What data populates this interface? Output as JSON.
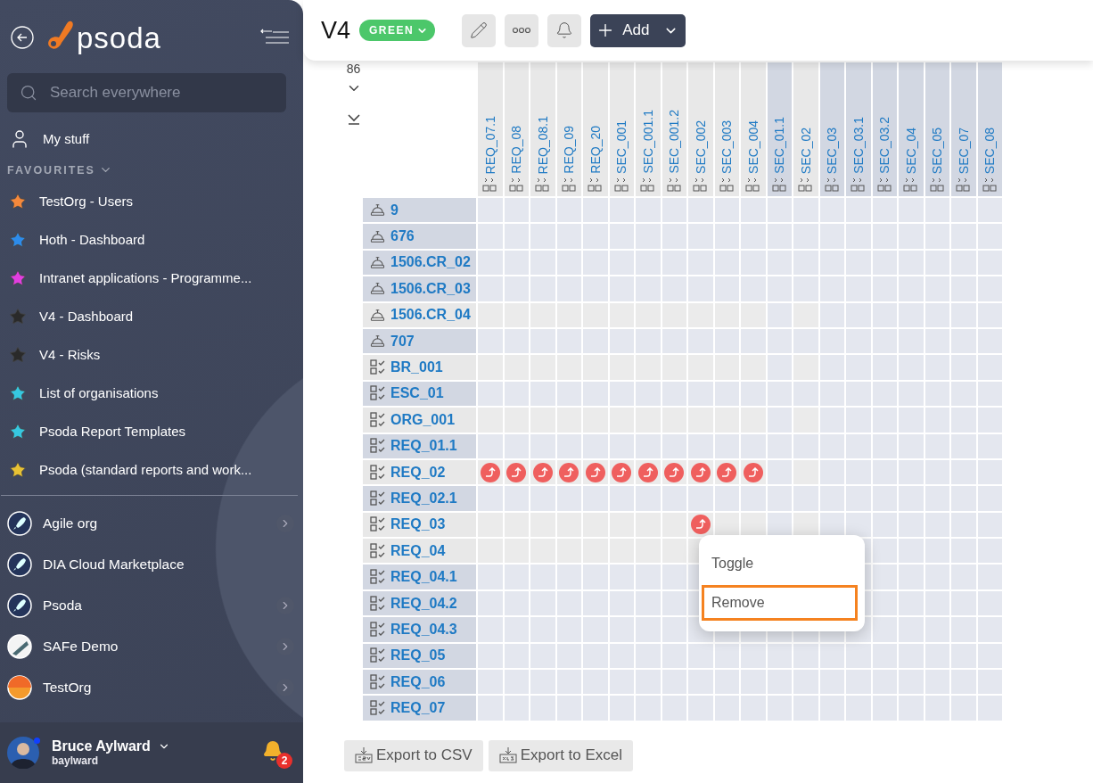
{
  "sidebar": {
    "logo": "psoda",
    "search": {
      "placeholder": "Search everywhere"
    },
    "my_stuff": "My stuff",
    "favourites": {
      "label": "FAVOURITES",
      "expanded": true,
      "items": [
        {
          "label": "TestOrg - Users",
          "color": "#f5893c"
        },
        {
          "label": "Hoth - Dashboard",
          "color": "#2d8ceb"
        },
        {
          "label": "Intranet applications - Programme...",
          "color": "#e23ee0"
        },
        {
          "label": "V4 - Dashboard",
          "color": "#2a2a2a"
        },
        {
          "label": "V4 - Risks",
          "color": "#2a2a2a"
        },
        {
          "label": "List of organisations",
          "color": "#36c8e0"
        },
        {
          "label": "Psoda Report Templates",
          "color": "#36c8e0"
        },
        {
          "label": "Psoda (standard reports and work...",
          "color": "#e8c234"
        }
      ]
    },
    "organisations": [
      {
        "label": "Agile org",
        "kind": "rocket",
        "has_children": true
      },
      {
        "label": "DIA Cloud Marketplace",
        "kind": "rocket",
        "has_children": false
      },
      {
        "label": "Psoda",
        "kind": "rocket",
        "has_children": true
      },
      {
        "label": "SAFe Demo",
        "kind": "stripes",
        "has_children": true
      },
      {
        "label": "TestOrg",
        "kind": "sunset",
        "has_children": true
      }
    ],
    "user": {
      "name": "Bruce Aylward",
      "username": "baylward",
      "online": true,
      "notifications": "2"
    }
  },
  "header": {
    "title": "V4",
    "status": "GREEN",
    "add_button": "Add"
  },
  "matrix": {
    "count": "86",
    "columns": [
      {
        "label": "REQ_07.1",
        "shaded": true
      },
      {
        "label": "REQ_08",
        "shaded": true
      },
      {
        "label": "REQ_08.1",
        "shaded": true
      },
      {
        "label": "REQ_09",
        "shaded": true
      },
      {
        "label": "REQ_20",
        "shaded": true
      },
      {
        "label": "SEC_001",
        "shaded": true
      },
      {
        "label": "SEC_001.1",
        "shaded": true
      },
      {
        "label": "SEC_001.2",
        "shaded": true
      },
      {
        "label": "SEC_002",
        "shaded": true
      },
      {
        "label": "SEC_003",
        "shaded": true
      },
      {
        "label": "SEC_004",
        "shaded": true
      },
      {
        "label": "SEC_01.1",
        "shaded": false
      },
      {
        "label": "SEC_02",
        "shaded": true
      },
      {
        "label": "SEC_03",
        "shaded": false
      },
      {
        "label": "SEC_03.1",
        "shaded": false
      },
      {
        "label": "SEC_03.2",
        "shaded": false
      },
      {
        "label": "SEC_04",
        "shaded": false
      },
      {
        "label": "SEC_05",
        "shaded": false
      },
      {
        "label": "SEC_07",
        "shaded": false
      },
      {
        "label": "SEC_08",
        "shaded": false
      }
    ],
    "rows": [
      {
        "label": "9",
        "kind": "bell",
        "shaded": false,
        "links": [
          false,
          false,
          false,
          false,
          false,
          false,
          false,
          false,
          false,
          false,
          false,
          false,
          false,
          false,
          false,
          false,
          false,
          false,
          false,
          false
        ]
      },
      {
        "label": "676",
        "kind": "bell",
        "shaded": false,
        "links": [
          false,
          false,
          false,
          false,
          false,
          false,
          false,
          false,
          false,
          false,
          false,
          false,
          false,
          false,
          false,
          false,
          false,
          false,
          false,
          false
        ]
      },
      {
        "label": "1506.CR_02",
        "kind": "bell",
        "shaded": false,
        "links": [
          false,
          false,
          false,
          false,
          false,
          false,
          false,
          false,
          false,
          false,
          false,
          false,
          false,
          false,
          false,
          false,
          false,
          false,
          false,
          false
        ]
      },
      {
        "label": "1506.CR_03",
        "kind": "bell",
        "shaded": false,
        "links": [
          false,
          false,
          false,
          false,
          false,
          false,
          false,
          false,
          false,
          false,
          false,
          false,
          false,
          false,
          false,
          false,
          false,
          false,
          false,
          false
        ]
      },
      {
        "label": "1506.CR_04",
        "kind": "bell",
        "shaded": true,
        "links": [
          false,
          false,
          false,
          false,
          false,
          false,
          false,
          false,
          false,
          false,
          false,
          false,
          false,
          false,
          false,
          false,
          false,
          false,
          false,
          false
        ]
      },
      {
        "label": "707",
        "kind": "bell",
        "shaded": false,
        "links": [
          false,
          false,
          false,
          false,
          false,
          false,
          false,
          false,
          false,
          false,
          false,
          false,
          false,
          false,
          false,
          false,
          false,
          false,
          false,
          false
        ]
      },
      {
        "label": "BR_001",
        "kind": "checklist",
        "shaded": true,
        "links": [
          false,
          false,
          false,
          false,
          false,
          false,
          false,
          false,
          false,
          false,
          false,
          false,
          false,
          false,
          false,
          false,
          false,
          false,
          false,
          false
        ]
      },
      {
        "label": "ESC_01",
        "kind": "checklist",
        "shaded": false,
        "links": [
          false,
          false,
          false,
          false,
          false,
          false,
          false,
          false,
          false,
          false,
          false,
          false,
          false,
          false,
          false,
          false,
          false,
          false,
          false,
          false
        ]
      },
      {
        "label": "ORG_001",
        "kind": "checklist",
        "shaded": true,
        "links": [
          false,
          false,
          false,
          false,
          false,
          false,
          false,
          false,
          false,
          false,
          false,
          false,
          false,
          false,
          false,
          false,
          false,
          false,
          false,
          false
        ]
      },
      {
        "label": "REQ_01.1",
        "kind": "checklist",
        "shaded": false,
        "links": [
          false,
          false,
          false,
          false,
          false,
          false,
          false,
          false,
          false,
          false,
          false,
          false,
          false,
          false,
          false,
          false,
          false,
          false,
          false,
          false
        ]
      },
      {
        "label": "REQ_02",
        "kind": "checklist",
        "shaded": true,
        "links": [
          true,
          true,
          true,
          true,
          true,
          true,
          true,
          true,
          true,
          true,
          true,
          false,
          false,
          false,
          false,
          false,
          false,
          false,
          false,
          false
        ]
      },
      {
        "label": "REQ_02.1",
        "kind": "checklist",
        "shaded": false,
        "links": [
          false,
          false,
          false,
          false,
          false,
          false,
          false,
          false,
          false,
          false,
          false,
          false,
          false,
          false,
          false,
          false,
          false,
          false,
          false,
          false
        ]
      },
      {
        "label": "REQ_03",
        "kind": "checklist",
        "shaded": true,
        "links": [
          false,
          false,
          false,
          false,
          false,
          false,
          false,
          false,
          true,
          false,
          false,
          false,
          false,
          false,
          false,
          false,
          false,
          false,
          false,
          false
        ]
      },
      {
        "label": "REQ_04",
        "kind": "checklist",
        "shaded": true
      },
      {
        "label": "REQ_04.1",
        "kind": "checklist",
        "shaded": false
      },
      {
        "label": "REQ_04.2",
        "kind": "checklist",
        "shaded": false
      },
      {
        "label": "REQ_04.3",
        "kind": "checklist",
        "shaded": false,
        "links": [
          false,
          false,
          false,
          false,
          false,
          false,
          false,
          false,
          false,
          false,
          false,
          false,
          false,
          false,
          false,
          false,
          false,
          false,
          false,
          false
        ]
      },
      {
        "label": "REQ_05",
        "kind": "checklist",
        "shaded": false,
        "links": [
          false,
          false,
          false,
          false,
          false,
          false,
          false,
          false,
          false,
          false,
          false,
          false,
          false,
          false,
          false,
          false,
          false,
          false,
          false,
          false
        ]
      },
      {
        "label": "REQ_06",
        "kind": "checklist",
        "shaded": false,
        "links": [
          false,
          false,
          false,
          false,
          false,
          false,
          false,
          false,
          false,
          false,
          false,
          false,
          false,
          false,
          false,
          false,
          false,
          false,
          false,
          false
        ]
      },
      {
        "label": "REQ_07",
        "kind": "checklist",
        "shaded": false,
        "links": [
          false,
          false,
          false,
          false,
          false,
          false,
          false,
          false,
          false,
          false,
          false,
          false,
          false,
          false,
          false,
          false,
          false,
          false,
          false,
          false
        ]
      }
    ],
    "context_menu": [
      {
        "label": "Toggle",
        "selected": false
      },
      {
        "label": "Remove",
        "selected": true
      }
    ]
  },
  "exports": [
    {
      "label": "Export to CSV",
      "kind": "csv"
    },
    {
      "label": "Export to Excel",
      "kind": "xlsx"
    }
  ]
}
